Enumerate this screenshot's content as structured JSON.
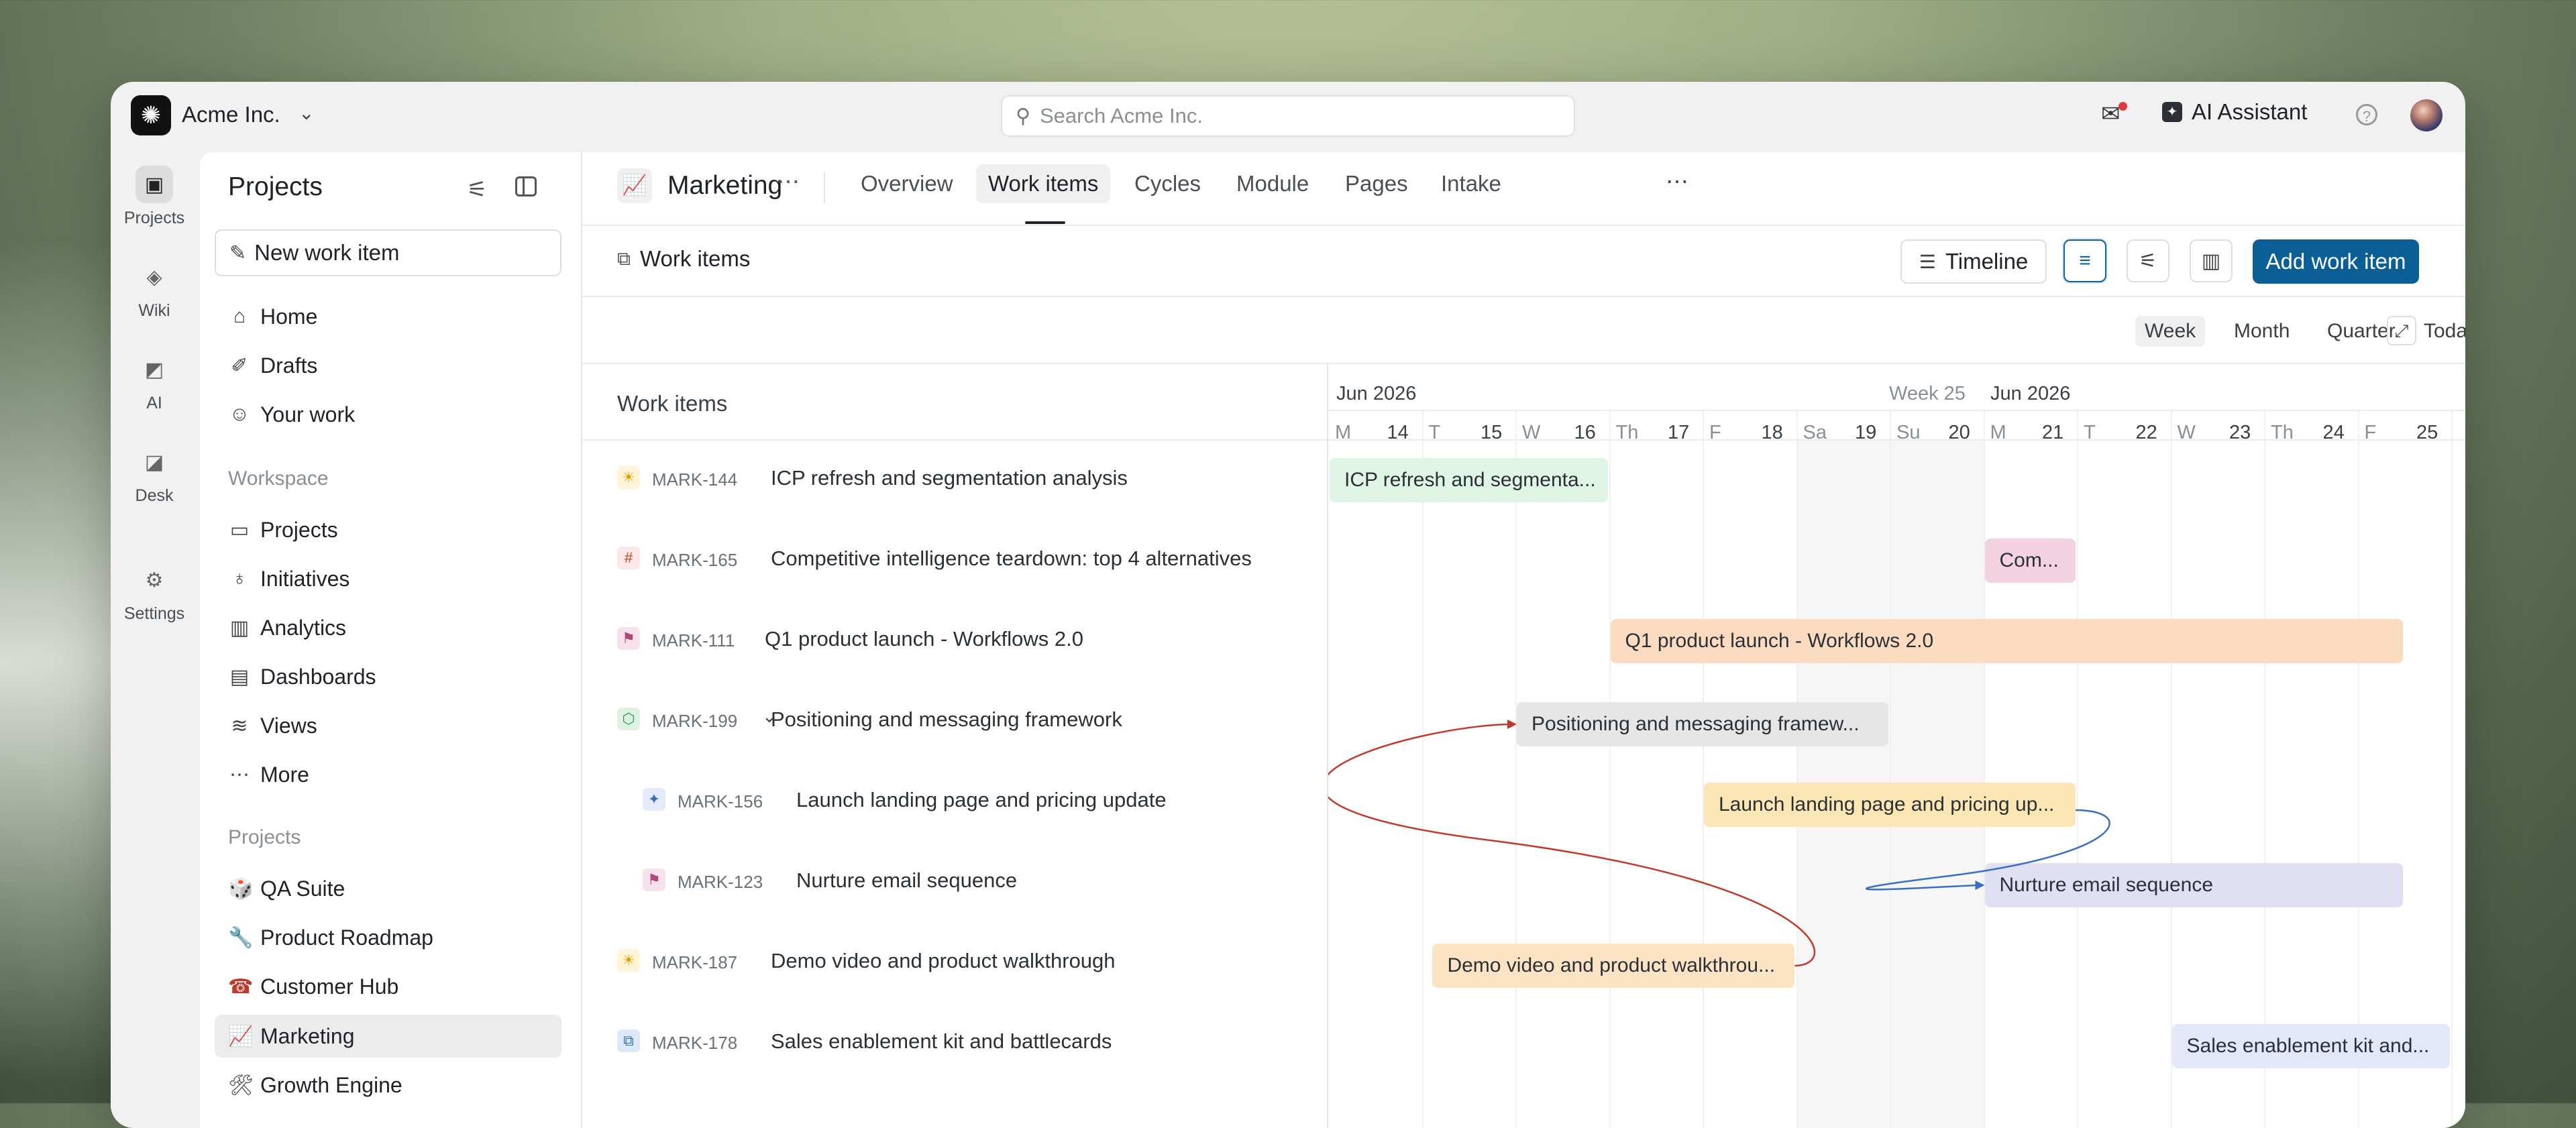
{
  "topbar": {
    "org_name": "Acme Inc.",
    "search_placeholder": "Search Acme Inc.",
    "ai_assistant": "AI Assistant"
  },
  "rail": [
    {
      "label": "Projects",
      "icon": "projects-icon",
      "active": true
    },
    {
      "label": "Wiki",
      "icon": "wiki-icon"
    },
    {
      "label": "AI",
      "icon": "ai-icon"
    },
    {
      "label": "Desk",
      "icon": "desk-icon"
    },
    {
      "label": "Settings",
      "icon": "gear-icon"
    }
  ],
  "sidebar": {
    "title": "Projects",
    "new_item": "New work item",
    "nav": [
      {
        "label": "Home",
        "icon": "home-icon"
      },
      {
        "label": "Drafts",
        "icon": "pencil-icon"
      },
      {
        "label": "Your work",
        "icon": "user-icon"
      }
    ],
    "workspace_heading": "Workspace",
    "workspace": [
      {
        "label": "Projects",
        "icon": "briefcase-icon"
      },
      {
        "label": "Initiatives",
        "icon": "lightbulb-icon"
      },
      {
        "label": "Analytics",
        "icon": "chart-icon"
      },
      {
        "label": "Dashboards",
        "icon": "dashboard-icon"
      },
      {
        "label": "Views",
        "icon": "layers-icon"
      },
      {
        "label": "More",
        "icon": "more-icon"
      }
    ],
    "projects_heading": "Projects",
    "projects": [
      {
        "label": "QA Suite",
        "emoji": "🎲"
      },
      {
        "label": "Product Roadmap",
        "emoji": "🔧"
      },
      {
        "label": "Customer Hub",
        "emoji": "☎"
      },
      {
        "label": "Marketing",
        "emoji": "📈",
        "selected": true
      },
      {
        "label": "Growth Engine",
        "emoji": "🛠"
      }
    ]
  },
  "project": {
    "name": "Marketing",
    "emoji": "📈",
    "tabs": [
      "Overview",
      "Work items",
      "Cycles",
      "Module",
      "Pages",
      "Intake"
    ],
    "active_tab": "Work items"
  },
  "toolbar": {
    "label": "Work items",
    "timeline": "Timeline",
    "add": "Add work item"
  },
  "scale": {
    "options": [
      "Week",
      "Month",
      "Quarter",
      "Today"
    ],
    "active": "Week"
  },
  "gantt": {
    "list_header": "Work items",
    "header": {
      "month_left": "Jun 2026",
      "week_label": "Week 25",
      "month_right": "Jun  2026",
      "days": [
        {
          "letter": "M",
          "num": "14"
        },
        {
          "letter": "T",
          "num": "15"
        },
        {
          "letter": "W",
          "num": "16"
        },
        {
          "letter": "Th",
          "num": "17"
        },
        {
          "letter": "F",
          "num": "18"
        },
        {
          "letter": "Sa",
          "num": "19"
        },
        {
          "letter": "Su",
          "num": "20"
        },
        {
          "letter": "M",
          "num": "21"
        },
        {
          "letter": "T",
          "num": "22"
        },
        {
          "letter": "W",
          "num": "23"
        },
        {
          "letter": "Th",
          "num": "24"
        },
        {
          "letter": "F",
          "num": "25"
        }
      ]
    },
    "rows": [
      {
        "key": "MARK-144",
        "title": "ICP refresh and segmentation analysis",
        "icon": "sun-icon",
        "bar": "ICP refresh and segmenta...",
        "color": "#dff5e6"
      },
      {
        "key": "MARK-165",
        "title": "Competitive intelligence teardown: top 4 alternatives",
        "icon": "hash-icon",
        "bar": "Com...",
        "color": "#f2d2e0"
      },
      {
        "key": "MARK-111",
        "title": "Q1 product launch - Workflows 2.0",
        "icon": "flag-icon",
        "bar": "Q1 product launch - Workflows 2.0",
        "color": "#fcdcc0"
      },
      {
        "key": "MARK-199",
        "title": "Positioning and messaging framework",
        "icon": "box-icon",
        "bar": "Positioning and messaging framew...",
        "color": "#e6e6e6"
      },
      {
        "key": "MARK-156",
        "title": "Launch landing page and pricing update",
        "icon": "sparkle-icon",
        "bar": "Launch landing page and pricing up...",
        "color": "#fbe6b4"
      },
      {
        "key": "MARK-123",
        "title": "Nurture email sequence",
        "icon": "flag-icon",
        "bar": "Nurture email sequence",
        "color": "#e0dff3"
      },
      {
        "key": "MARK-187",
        "title": "Demo video and product walkthrough",
        "icon": "sun-icon",
        "bar": "Demo video and product walkthrou...",
        "color": "#fce3c4"
      },
      {
        "key": "MARK-178",
        "title": "Sales enablement kit and battlecards",
        "icon": "cube-icon",
        "bar": "Sales enablement kit and...",
        "color": "#e2e8f7"
      }
    ],
    "colors": {
      "link_red": "#c0392b",
      "link_blue": "#3a6fc4",
      "accent": "#0b5f96"
    }
  }
}
